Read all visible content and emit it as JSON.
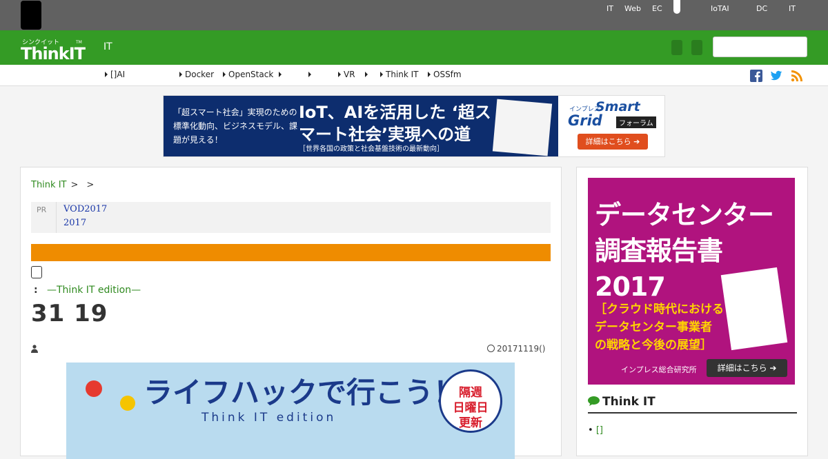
{
  "topbar": {
    "links": [
      "IT",
      "Web",
      "EC",
      "IoTAI",
      "DC",
      "IT"
    ]
  },
  "header": {
    "logo_kana": "シンクイット",
    "logo_text": "ThinkIT",
    "logo_tm": "TM",
    "section_label": "IT",
    "search_placeholder": ""
  },
  "subnav": {
    "items": [
      "[]AI",
      "Docker",
      "OpenStack",
      "",
      "",
      "VR",
      "",
      "Think IT",
      "OSSfm"
    ]
  },
  "banner": {
    "subtitle": "「超スマート社会」実現のための標準化動向、ビジネスモデル、課題が見える！",
    "main_title": "IoT、AIを活用した ‘超スマート社会’実現への道",
    "footer": "［世界各国の政策と社会基盤技術の最新動向］",
    "brand_prefix": "インプレス",
    "brand_smart": "Smart",
    "brand_grid": "Grid",
    "brand_forum": "フォーラム",
    "button": "詳細はこちら ➔"
  },
  "breadcrumb": {
    "home": "Think IT",
    "sep": ">"
  },
  "pr": {
    "label": "PR",
    "line1": "VOD2017",
    "line2": "2017"
  },
  "article": {
    "series_prefix": ":",
    "series_name": "—Think IT edition—",
    "title": "31 19",
    "date": "20171119()",
    "image_title": "ライフハックで行こう！",
    "image_edition": "Think IT edition",
    "badge_line1": "隔週",
    "badge_line2": "日曜日",
    "badge_line3": "更新"
  },
  "sidebar": {
    "ad_title_line1": "データセンター",
    "ad_title_line2": "調査報告書",
    "ad_title_line3": "2017",
    "ad_sub_line1": "［クラウド時代における",
    "ad_sub_line2": "データセンター事業者",
    "ad_sub_line3": "の戦略と今後の展望］",
    "ad_publisher": "インプレス総合研究所",
    "ad_button": "詳細はこちら ➔",
    "heading": "Think IT",
    "first_item": "[]"
  },
  "colors": {
    "brand_green": "#349b25",
    "topbar_gray": "#616161",
    "orange_bar": "#ef8c00",
    "sidebar_ad": "#b0137e"
  }
}
